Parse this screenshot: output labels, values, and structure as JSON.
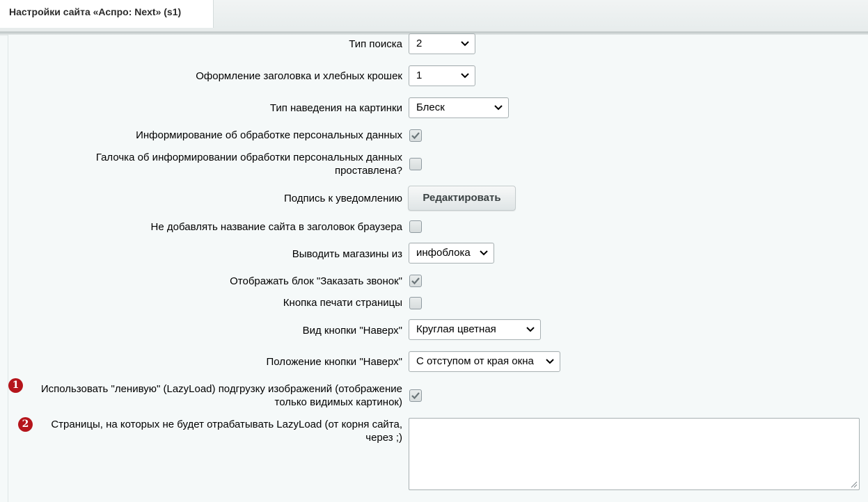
{
  "header": {
    "tab_title": "Настройки сайта «Аспро: Next» (s1)"
  },
  "settings": {
    "search_type": {
      "label": "Тип поиска",
      "value": "2"
    },
    "header_style": {
      "label": "Оформление заголовка и хлебных крошек",
      "value": "1"
    },
    "hover_type": {
      "label": "Тип наведения на картинки",
      "value": "Блеск"
    },
    "personal_data_info": {
      "label": "Информирование об обработке персональных данных",
      "checked": true
    },
    "personal_data_checkbox": {
      "label_line1": "Галочка об информировании обработки персональных данных",
      "label_line2": "проставлена?",
      "checked": false
    },
    "notice_signature": {
      "label": "Подпись к уведомлению",
      "button": "Редактировать"
    },
    "no_site_name_in_title": {
      "label": "Не добавлять название сайта в заголовок браузера",
      "checked": false
    },
    "stores_from": {
      "label": "Выводить магазины из",
      "value": "инфоблока"
    },
    "show_callback": {
      "label": "Отображать блок \"Заказать звонок\"",
      "checked": true
    },
    "print_button": {
      "label": "Кнопка печати страницы",
      "checked": false
    },
    "scroll_top_view": {
      "label": "Вид кнопки \"Наверх\"",
      "value": "Круглая цветная"
    },
    "scroll_top_position": {
      "label": "Положение кнопки \"Наверх\"",
      "value": "С отступом от края окна"
    },
    "lazyload": {
      "marker": "1",
      "label_line1": "Использовать \"ленивую\" (LazyLoad) подгрузку изображений (отображение",
      "label_line2": "только видимых картинок)",
      "checked": true
    },
    "lazyload_exclude": {
      "marker": "2",
      "label_line1": "Страницы, на которых не будет отрабатывать LazyLoad (от корня сайта,",
      "label_line2": "через ;)",
      "value": ""
    }
  },
  "colors": {
    "marker": "#b5151b",
    "check": "#6a7478"
  },
  "icons": {
    "select_arrow": "chevron-down-icon",
    "check": "check-icon",
    "resize": "resize-grip-icon"
  }
}
